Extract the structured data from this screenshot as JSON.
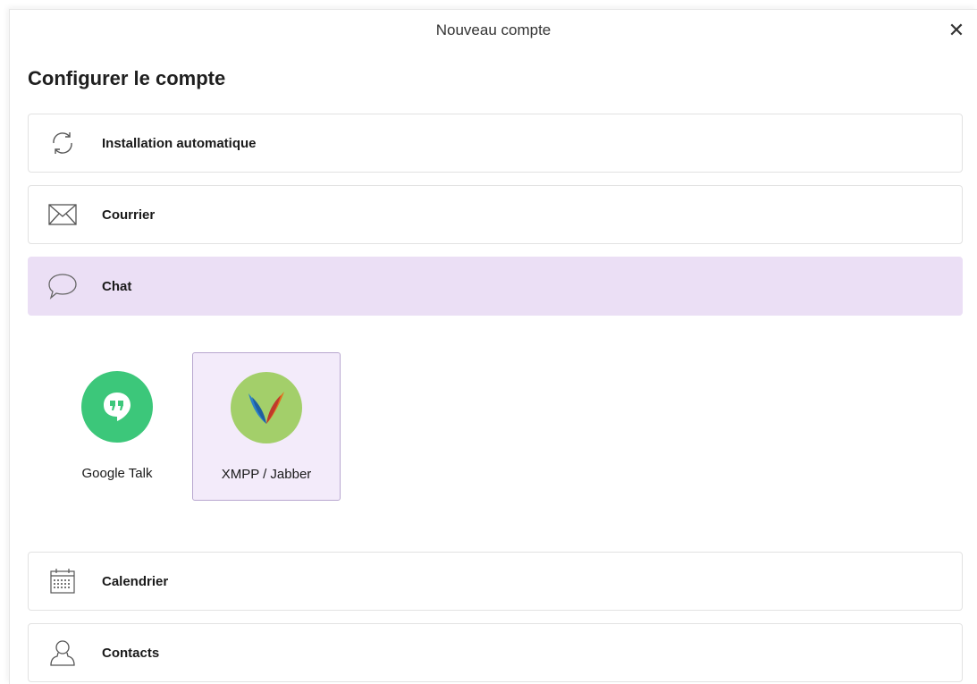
{
  "window": {
    "title": "Nouveau compte",
    "close_label": "✕"
  },
  "heading": "Configurer le compte",
  "rows": {
    "auto": {
      "label": "Installation automatique",
      "icon": "sync-icon"
    },
    "mail": {
      "label": "Courrier",
      "icon": "envelope-icon"
    },
    "chat": {
      "label": "Chat",
      "icon": "chat-bubble-icon"
    },
    "calendar": {
      "label": "Calendrier",
      "icon": "calendar-icon"
    },
    "contacts": {
      "label": "Contacts",
      "icon": "person-icon"
    }
  },
  "chat_services": [
    {
      "label": "Google Talk",
      "icon": "google-talk-icon",
      "color": "#3cc77a"
    },
    {
      "label": "XMPP / Jabber",
      "icon": "xmpp-icon",
      "color": "#a3cf6a"
    }
  ],
  "colors": {
    "selected_row": "#ebdff5",
    "selected_tile": "#f3ebfa",
    "tile_border": "#b8a6cf"
  }
}
